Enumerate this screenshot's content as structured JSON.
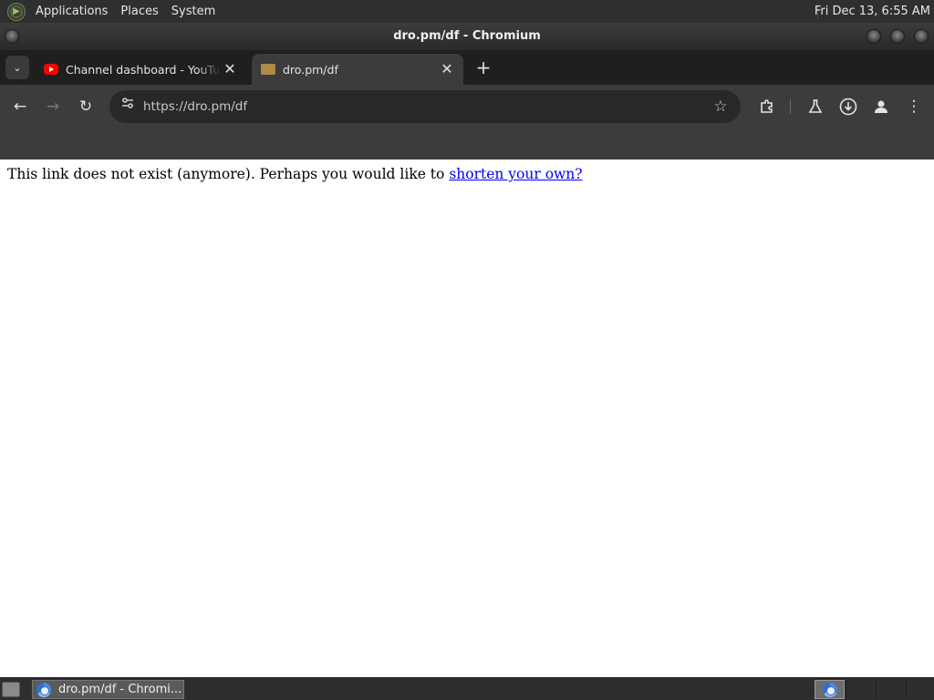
{
  "top_panel": {
    "menus": [
      "Applications",
      "Places",
      "System"
    ],
    "clock": "Fri Dec 13,  6:55 AM"
  },
  "window": {
    "title": "dro.pm/df - Chromium"
  },
  "tabs": [
    {
      "title": "Channel dashboard - YouTube",
      "favicon": "youtube-icon",
      "active": false
    },
    {
      "title": "dro.pm/df",
      "favicon": "folder-icon",
      "active": true
    }
  ],
  "toolbar": {
    "url": "https://dro.pm/df",
    "back": "←",
    "forward": "→",
    "reload": "↻"
  },
  "page": {
    "message": "This link does not exist (anymore). Perhaps you would like to ",
    "link_text": "shorten your own?"
  },
  "taskbar": {
    "task_label": "dro.pm/df - Chromi..."
  },
  "colors": {
    "panel_bg": "#2f2f2f",
    "toolbar_bg": "#3c3c3c",
    "tabstrip_bg": "#1f1f1f",
    "link": "#0000ee"
  }
}
